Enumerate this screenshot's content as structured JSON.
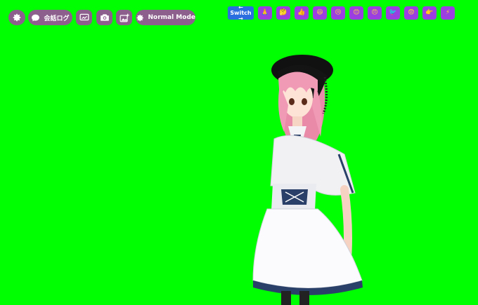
{
  "toolbar": {
    "settings_icon": "gear-icon",
    "chat_log_label": "会話ログ",
    "chat_icon": "chat-bubble-icon",
    "share_icon": "screen-share-icon",
    "camera_icon": "camera-icon",
    "image_add_icon": "image-add-icon",
    "mode_icon": "gear-icon",
    "mode_label": "Normal Mode"
  },
  "switch": {
    "line1": "← Switch",
    "line2": "→"
  },
  "emotes": [
    {
      "name": "pray",
      "glyph": "🙏"
    },
    {
      "name": "think",
      "glyph": "🤔"
    },
    {
      "name": "thumbs",
      "glyph": "👍"
    },
    {
      "name": "laugh",
      "glyph": "😆"
    },
    {
      "name": "sad",
      "glyph": "😢"
    },
    {
      "name": "smile",
      "glyph": "😊"
    },
    {
      "name": "angry",
      "glyph": "😠"
    },
    {
      "name": "bird",
      "glyph": "🐦"
    },
    {
      "name": "fear",
      "glyph": "😨"
    },
    {
      "name": "point",
      "glyph": "👉"
    },
    {
      "name": "flash",
      "glyph": "⚡"
    }
  ],
  "colors": {
    "background": "#00ff00",
    "toolbar_button": "#8c5f8c",
    "switch_button": "#2a6ee0",
    "emote_button": "#9b3fe0"
  }
}
